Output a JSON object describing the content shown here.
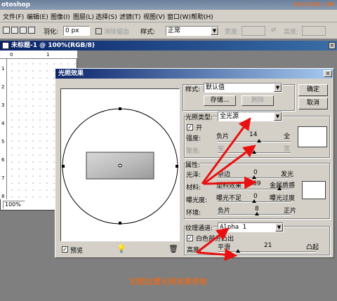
{
  "app": {
    "title": "otoshop",
    "watermark": "66SJCWCN.COM"
  },
  "menu": [
    "文件(F)",
    "编辑(E)",
    "图像(I)",
    "图层(L)",
    "选择(S)",
    "滤镜(T)",
    "视图(V)",
    "窗口(W)",
    "帮助(H)"
  ],
  "options_bar": {
    "feather_label": "羽化:",
    "feather_value": "0 px",
    "antialias_label": "消除锯齿",
    "style_label": "样式:",
    "style_value": "正常",
    "width_label": "宽度:",
    "height_label": "高度:"
  },
  "document": {
    "title": "未标题-1 @ 100%(RGB/8)",
    "zoom": "100%",
    "ruler_top": [
      "0",
      "1"
    ],
    "ruler_left": [
      "1",
      "2",
      "3",
      "4",
      "5",
      "6",
      "7",
      "8"
    ]
  },
  "dialog": {
    "title": "光照效果",
    "ok_label": "确定",
    "cancel_label": "取消",
    "style_label": "样式:",
    "style_value": "默认值",
    "save_label": "存储...",
    "delete_label": "删除",
    "light_type_label": "光照类型:",
    "light_type_value": "全光源",
    "on_label": "开",
    "on_checked": true,
    "intensity_label": "强度:",
    "intensity_left": "负片",
    "intensity_value": "14",
    "intensity_right": "全",
    "intensity_fraction": 0.57,
    "focus_label": "聚焦:",
    "focus_left": "窄",
    "focus_right": "宽",
    "focus_fraction": 0.5,
    "properties_label": "属性:",
    "gloss_label": "光泽:",
    "gloss_left": "杂边",
    "gloss_value": "0",
    "gloss_right": "发光",
    "gloss_fraction": 0.5,
    "material_label": "材料:",
    "material_left": "塑料效果",
    "material_value": "69",
    "material_right": "金属质感",
    "material_fraction": 0.85,
    "exposure_label": "曝光度:",
    "exposure_left": "曝光不足",
    "exposure_value": "0",
    "exposure_right": "曝光过度",
    "exposure_fraction": 0.5,
    "ambience_label": "环境:",
    "ambience_left": "负片",
    "ambience_value": "8",
    "ambience_right": "正片",
    "ambience_fraction": 0.54,
    "texture_label": "纹理通道:",
    "texture_value": "Alpha 1",
    "white_high_label": "白色部分凸出",
    "white_high_checked": true,
    "height_label": "高度:",
    "height_left": "平滑",
    "height_value": "21",
    "height_right": "凸起",
    "height_fraction": 0.21,
    "preview_label": "预览",
    "preview_checked": true
  },
  "caption": "如图设置光照效果参数",
  "colors": {
    "annotation_arrow": "#e81010",
    "caption": "#ff6600",
    "dialog_title_start": "#0a246a"
  }
}
